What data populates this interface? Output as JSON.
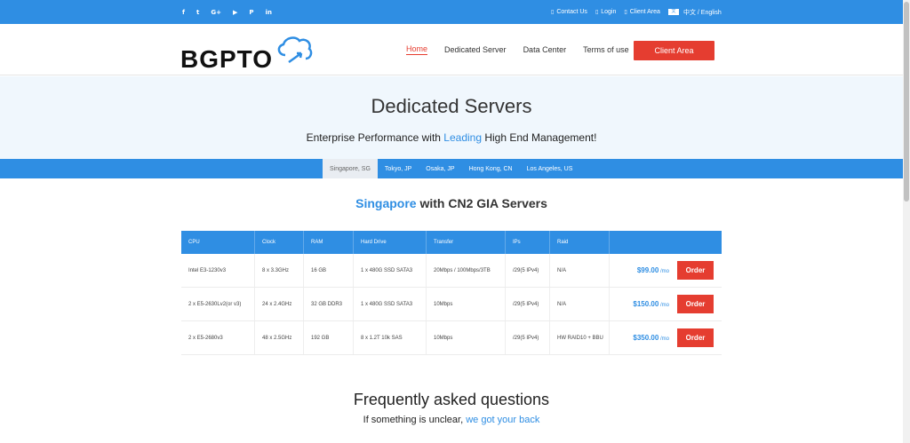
{
  "topbar": {
    "social": [
      "f",
      "t",
      "G+",
      "▶",
      "P",
      "in"
    ],
    "social_icons": [
      "facebook-icon",
      "twitter-icon",
      "google-plus-icon",
      "youtube-icon",
      "pinterest-icon",
      "linkedin-icon"
    ],
    "links": [
      {
        "icon": "▯",
        "label": "Contact Us"
      },
      {
        "icon": "▯",
        "label": "Login"
      },
      {
        "icon": "▯",
        "label": "Client Area"
      }
    ],
    "language": "中文 / English"
  },
  "header": {
    "logo_text": "BGPTO",
    "nav": [
      "Home",
      "Dedicated Server",
      "Data Center",
      "Terms of use"
    ],
    "client_button": "Client Area"
  },
  "hero": {
    "title": "Dedicated Servers",
    "subtitle_pre": "Enterprise Performance with ",
    "subtitle_highlight": "Leading",
    "subtitle_post": " High End Management!"
  },
  "tabs": [
    "Singapore, SG",
    "Tokyo, JP",
    "Osaka, JP",
    "Hong Kong, CN",
    "Los Angeles, US"
  ],
  "section": {
    "title_highlight": "Singapore",
    "title_rest": " with CN2 GIA Servers"
  },
  "table": {
    "headers": [
      "CPU",
      "Clock",
      "RAM",
      "Hard Drive",
      "Transfer",
      "IPs",
      "Raid",
      ""
    ],
    "rows": [
      {
        "cpu": "Intel E3-1230v3",
        "clock": "8 x 3.3GHz",
        "ram": "16 GB",
        "drive": "1 x 480G SSD SATA3",
        "transfer": "20Mbps / 100Mbps/3TB",
        "ips": "/29(5 IPv4)",
        "raid": "N/A",
        "price": "$99.00",
        "unit": " /mo",
        "order": "Order"
      },
      {
        "cpu": "2 x E5-2630Lv2(or v3)",
        "clock": "24 x 2.4GHz",
        "ram": "32 GB DDR3",
        "drive": "1 x 480G SSD SATA3",
        "transfer": "10Mbps",
        "ips": "/29(5 IPv4)",
        "raid": "N/A",
        "price": "$150.00",
        "unit": " /mo",
        "order": "Order"
      },
      {
        "cpu": "2 x E5-2680v3",
        "clock": "48 x 2.5GHz",
        "ram": "192 GB",
        "drive": "8 x 1.2T 10k SAS",
        "transfer": "10Mbps",
        "ips": "/29(5 IPv4)",
        "raid": "HW RAID10 + BBU",
        "price": "$350.00",
        "unit": " /mo",
        "order": "Order"
      }
    ]
  },
  "faq": {
    "title": "Frequently asked questions",
    "subtitle_pre": "If something is unclear, ",
    "subtitle_link": "we got your back"
  },
  "colors": {
    "primary": "#2f8ee3",
    "accent": "#e53d30"
  }
}
